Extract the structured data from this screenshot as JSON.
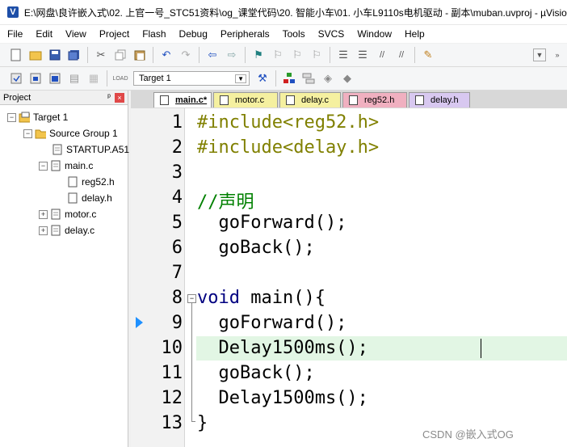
{
  "window": {
    "title": "E:\\网盘\\良许嵌入式\\02. 上官一号_STC51资料\\og_课堂代码\\20. 智能小车\\01. 小车L9110s电机驱动 - 副本\\muban.uvproj - µVision",
    "app_icon": "V"
  },
  "menu": {
    "items": [
      "File",
      "Edit",
      "View",
      "Project",
      "Flash",
      "Debug",
      "Peripherals",
      "Tools",
      "SVCS",
      "Window",
      "Help"
    ]
  },
  "toolbar2": {
    "target_value": "Target 1"
  },
  "project_panel": {
    "title": "Project",
    "pin": "ᵖ",
    "close": "×",
    "tree": [
      {
        "label": "Target 1",
        "expander": "−",
        "icon": "target"
      },
      {
        "label": "Source Group 1",
        "expander": "−",
        "icon": "folder"
      },
      {
        "label": "STARTUP.A51",
        "expander": "",
        "icon": "file"
      },
      {
        "label": "main.c",
        "expander": "−",
        "icon": "file"
      },
      {
        "label": "reg52.h",
        "expander": "",
        "icon": "file"
      },
      {
        "label": "delay.h",
        "expander": "",
        "icon": "file"
      },
      {
        "label": "motor.c",
        "expander": "+",
        "icon": "file"
      },
      {
        "label": "delay.c",
        "expander": "+",
        "icon": "file"
      }
    ]
  },
  "editor_tabs": [
    {
      "label": "main.c*",
      "color": "#ffffff",
      "active": true
    },
    {
      "label": "motor.c",
      "color": "#f5f0a0",
      "active": false
    },
    {
      "label": "delay.c",
      "color": "#f5f0a0",
      "active": false
    },
    {
      "label": "reg52.h",
      "color": "#f0b0c0",
      "active": false
    },
    {
      "label": "delay.h",
      "color": "#d8c8f0",
      "active": false
    }
  ],
  "editor": {
    "line_numbers": [
      "1",
      "2",
      "3",
      "4",
      "5",
      "6",
      "7",
      "8",
      "9",
      "10",
      "11",
      "12",
      "13"
    ],
    "lines": [
      {
        "text": "#include<reg52.h>",
        "kind": "preprocessor"
      },
      {
        "text": "#include<delay.h>",
        "kind": "preprocessor"
      },
      {
        "text": "",
        "kind": "plain"
      },
      {
        "text": "//声明",
        "kind": "comment"
      },
      {
        "text": "  goForward();",
        "kind": "plain"
      },
      {
        "text": "  goBack();",
        "kind": "plain"
      },
      {
        "text": "",
        "kind": "plain"
      },
      {
        "text": "void main(){",
        "kind": "keyword-line"
      },
      {
        "text": "  goForward();",
        "kind": "plain"
      },
      {
        "text": "  Delay1500ms();",
        "kind": "plain"
      },
      {
        "text": "  goBack();",
        "kind": "plain"
      },
      {
        "text": "  Delay1500ms();",
        "kind": "plain"
      },
      {
        "text": "}",
        "kind": "plain"
      }
    ],
    "fold_symbol": "−"
  },
  "watermark": "CSDN @嵌入式OG",
  "colors": {
    "preprocessor": "#808000",
    "comment": "#008000",
    "keyword": "#000080",
    "highlight_line": "#e2f6e4",
    "exec_marker": "#1e90ff"
  }
}
